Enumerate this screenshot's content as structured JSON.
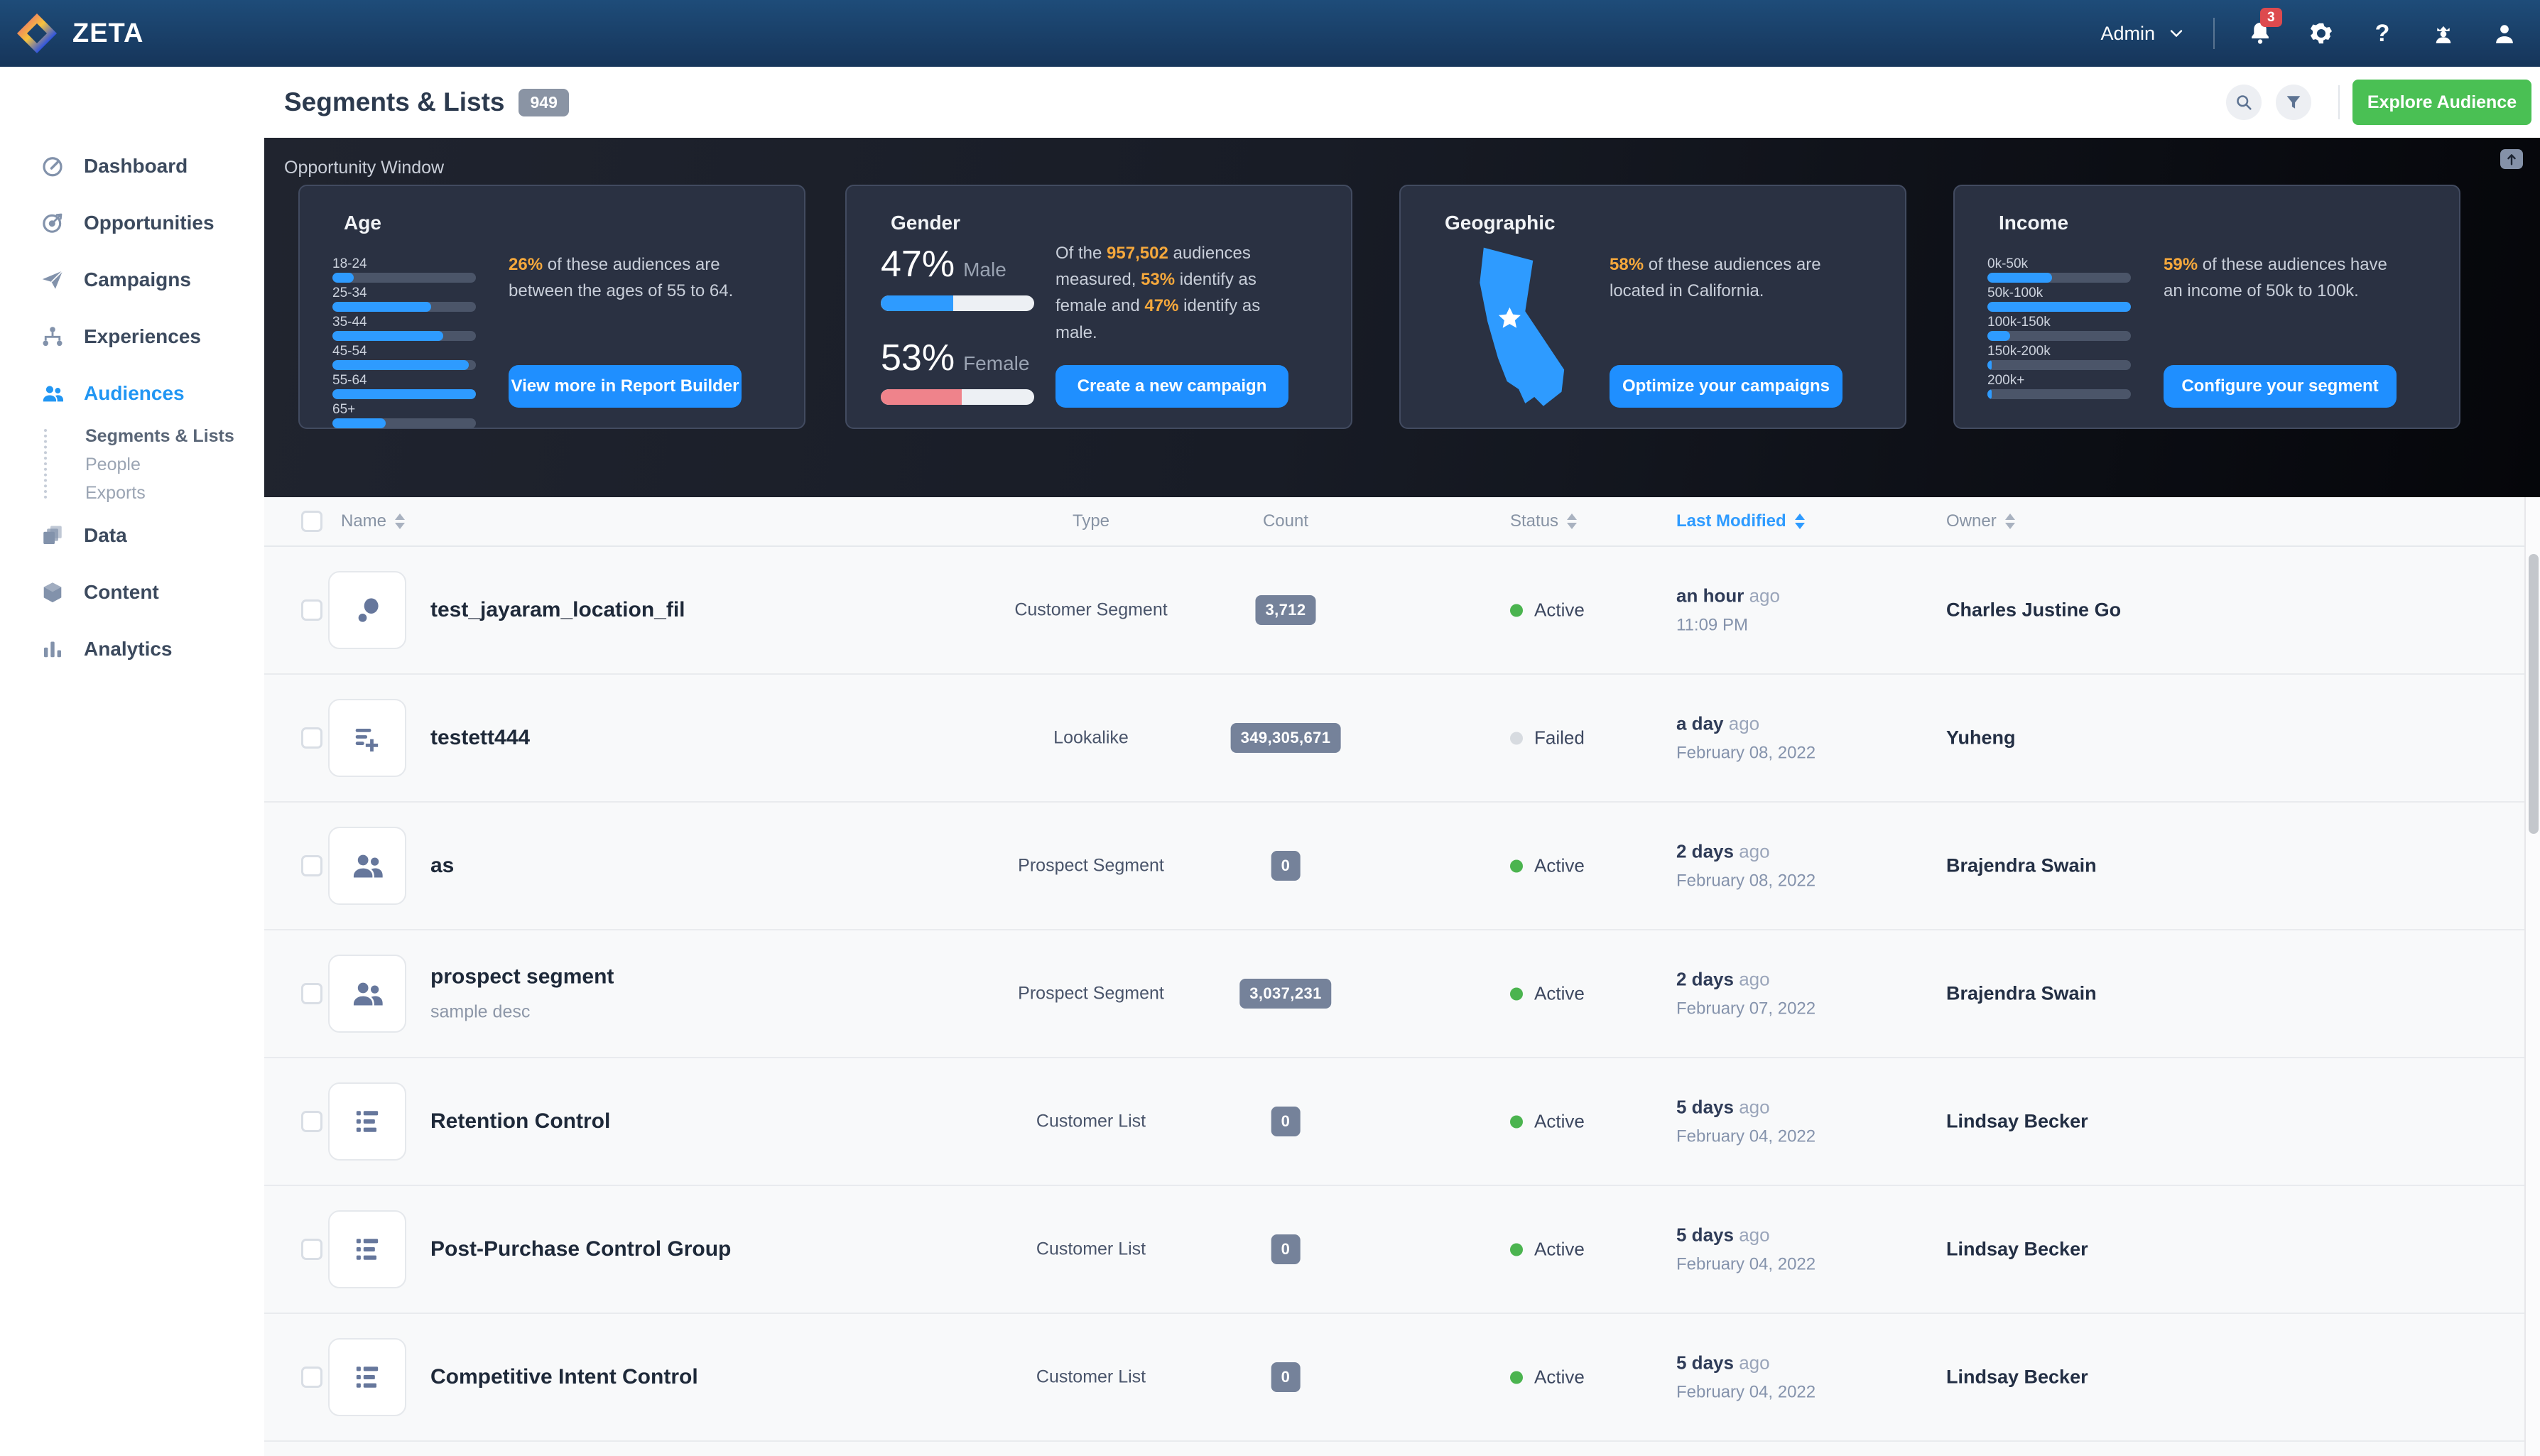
{
  "nav": {
    "brand": "ZETA",
    "user_menu_label": "Admin",
    "notification_count": "3",
    "help_glyph": "?"
  },
  "sidebar": {
    "items": [
      {
        "label": "Dashboard",
        "icon": "gauge-icon",
        "active": false
      },
      {
        "label": "Opportunities",
        "icon": "target-icon",
        "active": false
      },
      {
        "label": "Campaigns",
        "icon": "paper-plane-icon",
        "active": false
      },
      {
        "label": "Experiences",
        "icon": "tree-icon",
        "active": false
      },
      {
        "label": "Audiences",
        "icon": "people-icon",
        "active": true,
        "children": [
          {
            "label": "Segments & Lists",
            "active": true
          },
          {
            "label": "People",
            "active": false
          },
          {
            "label": "Exports",
            "active": false
          }
        ]
      },
      {
        "label": "Data",
        "icon": "layers-icon",
        "active": false
      },
      {
        "label": "Content",
        "icon": "cube-icon",
        "active": false
      },
      {
        "label": "Analytics",
        "icon": "bar-chart-icon",
        "active": false
      }
    ]
  },
  "header": {
    "title": "Segments & Lists",
    "count_badge": "949",
    "explore_button_label": "Explore Audience"
  },
  "opportunity": {
    "title": "Opportunity Window",
    "accent_color": "#f5a83c",
    "cards": {
      "age": {
        "title": "Age",
        "bars": [
          {
            "label": "18-24",
            "fill_pct": 15
          },
          {
            "label": "25-34",
            "fill_pct": 69
          },
          {
            "label": "35-44",
            "fill_pct": 77
          },
          {
            "label": "45-54",
            "fill_pct": 95
          },
          {
            "label": "55-64",
            "fill_pct": 100
          },
          {
            "label": "65+",
            "fill_pct": 37
          }
        ],
        "text_parts": [
          {
            "t": "26%",
            "hl": true
          },
          {
            "t": " of these audiences are between the ages of 55 to 64.",
            "hl": false
          }
        ],
        "button_label": "View more in Report Builder"
      },
      "gender": {
        "title": "Gender",
        "stats": [
          {
            "value": "47%",
            "label": "Male",
            "percent": 47,
            "color": "#2e9bff"
          },
          {
            "value": "53%",
            "label": "Female",
            "percent": 53,
            "color": "#ef838b"
          }
        ],
        "text_parts": [
          {
            "t": "Of the ",
            "hl": false
          },
          {
            "t": "957,502",
            "hl": true
          },
          {
            "t": " audiences measured, ",
            "hl": false
          },
          {
            "t": "53%",
            "hl": true
          },
          {
            "t": " identify as female and ",
            "hl": false
          },
          {
            "t": "47%",
            "hl": true
          },
          {
            "t": " identify as male.",
            "hl": false
          }
        ],
        "button_label": "Create a new campaign"
      },
      "geographic": {
        "title": "Geographic",
        "map": "california-shape",
        "text_parts": [
          {
            "t": "58%",
            "hl": true
          },
          {
            "t": " of these audiences are located in California.",
            "hl": false
          }
        ],
        "button_label": "Optimize your campaigns"
      },
      "income": {
        "title": "Income",
        "bars": [
          {
            "label": "0k-50k",
            "fill_pct": 45
          },
          {
            "label": "50k-100k",
            "fill_pct": 100
          },
          {
            "label": "100k-150k",
            "fill_pct": 16
          },
          {
            "label": "150k-200k",
            "fill_pct": 3
          },
          {
            "label": "200k+",
            "fill_pct": 3
          }
        ],
        "text_parts": [
          {
            "t": "59%",
            "hl": true
          },
          {
            "t": " of these audiences have an income of 50k to 100k.",
            "hl": false
          }
        ],
        "button_label": "Configure your segment"
      }
    }
  },
  "table": {
    "columns": [
      {
        "label": "Name",
        "sortable": true,
        "active": false
      },
      {
        "label": "Type",
        "sortable": false,
        "active": false
      },
      {
        "label": "Count",
        "sortable": false,
        "active": false
      },
      {
        "label": "Status",
        "sortable": true,
        "active": false
      },
      {
        "label": "Last Modified",
        "sortable": true,
        "active": true
      },
      {
        "label": "Owner",
        "sortable": true,
        "active": false
      }
    ],
    "rows": [
      {
        "icon": "scatter-icon",
        "name": "test_jayaram_location_fil",
        "desc": null,
        "type": "Customer Segment",
        "count": "3,712",
        "status": {
          "label": "Active",
          "state": "active"
        },
        "modified": {
          "rel": "an hour",
          "suffix": "ago",
          "detail": "11:09 PM"
        },
        "owner": "Charles Justine Go"
      },
      {
        "icon": "playlist-add-icon",
        "name": "testett444",
        "desc": null,
        "type": "Lookalike",
        "count": "349,305,671",
        "status": {
          "label": "Failed",
          "state": "failed"
        },
        "modified": {
          "rel": "a day",
          "suffix": "ago",
          "detail": "February 08, 2022"
        },
        "owner": "Yuheng"
      },
      {
        "icon": "people-icon",
        "name": "as",
        "desc": null,
        "type": "Prospect Segment",
        "count": "0",
        "status": {
          "label": "Active",
          "state": "active"
        },
        "modified": {
          "rel": "2 days",
          "suffix": "ago",
          "detail": "February 08, 2022"
        },
        "owner": "Brajendra Swain"
      },
      {
        "icon": "people-icon",
        "name": "prospect segment",
        "desc": "sample desc",
        "type": "Prospect Segment",
        "count": "3,037,231",
        "status": {
          "label": "Active",
          "state": "active"
        },
        "modified": {
          "rel": "2 days",
          "suffix": "ago",
          "detail": "February 07, 2022"
        },
        "owner": "Brajendra Swain"
      },
      {
        "icon": "list-icon",
        "name": "Retention Control",
        "desc": null,
        "type": "Customer List",
        "count": "0",
        "status": {
          "label": "Active",
          "state": "active"
        },
        "modified": {
          "rel": "5 days",
          "suffix": "ago",
          "detail": "February 04, 2022"
        },
        "owner": "Lindsay Becker"
      },
      {
        "icon": "list-icon",
        "name": "Post-Purchase Control Group",
        "desc": null,
        "type": "Customer List",
        "count": "0",
        "status": {
          "label": "Active",
          "state": "active"
        },
        "modified": {
          "rel": "5 days",
          "suffix": "ago",
          "detail": "February 04, 2022"
        },
        "owner": "Lindsay Becker"
      },
      {
        "icon": "list-icon",
        "name": "Competitive Intent Control",
        "desc": null,
        "type": "Customer List",
        "count": "0",
        "status": {
          "label": "Active",
          "state": "active"
        },
        "modified": {
          "rel": "5 days",
          "suffix": "ago",
          "detail": "February 04, 2022"
        },
        "owner": "Lindsay Becker"
      }
    ]
  }
}
